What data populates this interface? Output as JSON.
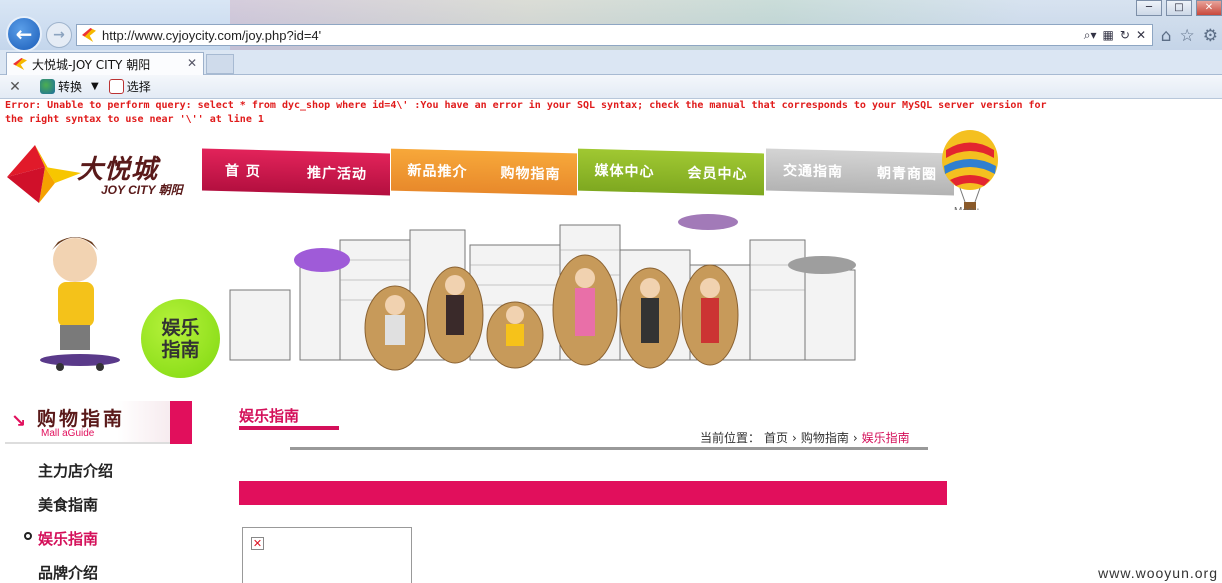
{
  "browser": {
    "url": "http://www.cyjoycity.com/joy.php?id=4'",
    "tab_title": "大悦城-JOY CITY 朝阳",
    "commands": {
      "convert": "转换",
      "select": "选择"
    }
  },
  "error": {
    "line1": "Error: Unable to perform query: select * from dyc_shop where id=4\\' :You have an error in your SQL syntax; check the manual that corresponds to your MySQL server version for",
    "line2": "the right syntax to use near '\\'' at line 1"
  },
  "logo": {
    "cn": "大悦城",
    "en": "JOY CITY 朝阳"
  },
  "menu": [
    [
      "首 页",
      "推广活动"
    ],
    [
      "新品推介",
      "购物指南"
    ],
    [
      "媒体中心",
      "会员中心"
    ],
    [
      "交通指南",
      "朝青商圈"
    ]
  ],
  "balloon_label": "Menu",
  "banner": {
    "circle_line1": "娱乐",
    "circle_line2": "指南"
  },
  "sidebar": {
    "title": "购物指南",
    "subtitle": "Mall aGuide",
    "items": [
      {
        "label": "主力店介绍",
        "active": false
      },
      {
        "label": "美食指南",
        "active": false
      },
      {
        "label": "娱乐指南",
        "active": true
      },
      {
        "label": "品牌介绍",
        "active": false
      }
    ]
  },
  "content": {
    "title": "娱乐指南",
    "crumbs": {
      "prefix": "当前位置：",
      "home": "首页",
      "section": "购物指南",
      "current": "娱乐指南"
    }
  },
  "watermark": "www.wooyun.org",
  "colors": {
    "brand": "#e10f5c",
    "error": "#e01b1b"
  }
}
